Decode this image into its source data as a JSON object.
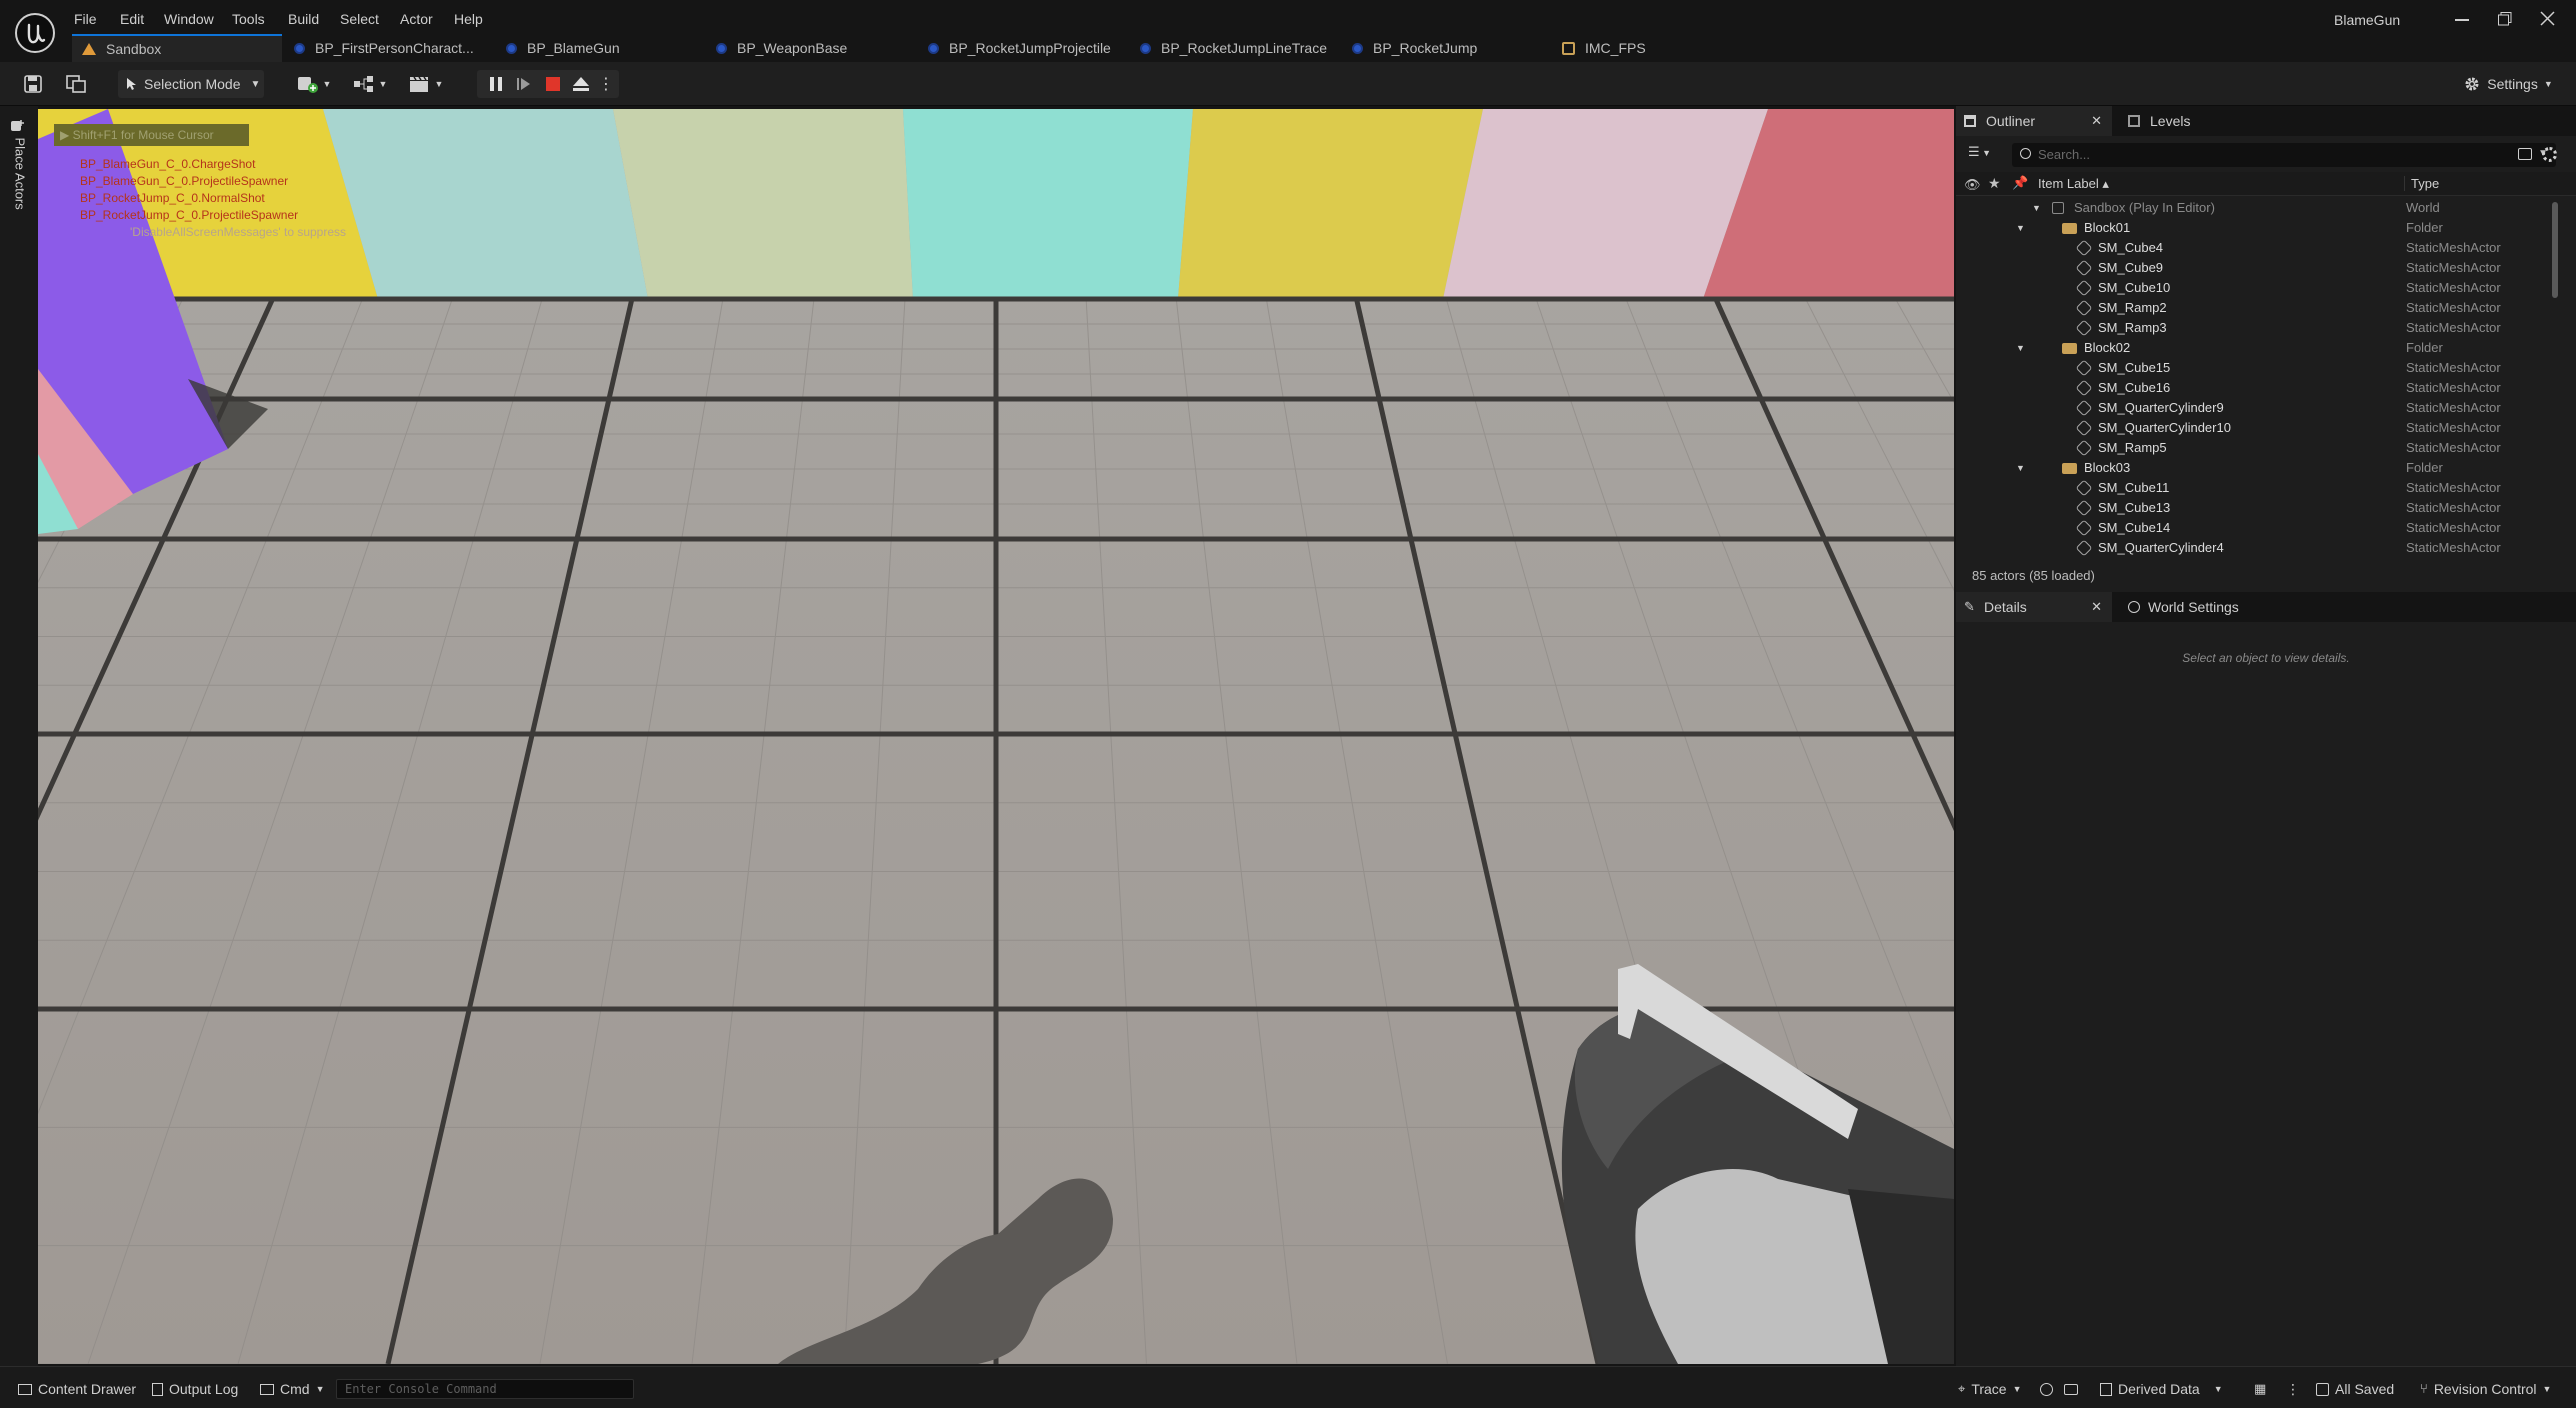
{
  "window": {
    "project_name": "BlameGun"
  },
  "menu": [
    "File",
    "Edit",
    "Window",
    "Tools",
    "Build",
    "Select",
    "Actor",
    "Help"
  ],
  "tabs": [
    {
      "label": "Sandbox",
      "icon": "level-icon"
    },
    {
      "label": "BP_FirstPersonCharact...",
      "icon": "blueprint-actor-icon"
    },
    {
      "label": "BP_BlameGun",
      "icon": "blueprint-icon"
    },
    {
      "label": "BP_WeaponBase",
      "icon": "blueprint-icon"
    },
    {
      "label": "BP_RocketJumpProjectile",
      "icon": "blueprint-icon"
    },
    {
      "label": "BP_RocketJumpLineTrace",
      "icon": "blueprint-icon"
    },
    {
      "label": "BP_RocketJump",
      "icon": "blueprint-icon"
    },
    {
      "label": "IMC_FPS",
      "icon": "input-mapping-icon"
    }
  ],
  "toolbar": {
    "selection_mode": "Selection Mode",
    "settings": "Settings"
  },
  "left_strip": {
    "label": "Place Actors"
  },
  "viewport": {
    "hint": "Shift+F1 for Mouse Cursor",
    "messages": [
      "BP_BlameGun_C_0.ChargeShot",
      "BP_BlameGun_C_0.ProjectileSpawner",
      "BP_RocketJump_C_0.NormalShot",
      "BP_RocketJump_C_0.ProjectileSpawner"
    ],
    "suppress_hint": "'DisableAllScreenMessages' to suppress",
    "colors": {
      "stripe1": "#e7d33a",
      "stripe2": "#a9d6d0",
      "stripe3": "#c8d3ab",
      "stripe4": "#8fded1",
      "stripe5": "#dccb4c",
      "stripe6": "#dcc1cd",
      "stripe7": "#cf6f79",
      "floor": "#a49f9a",
      "purple": "#8d5ce6"
    }
  },
  "outliner": {
    "tab": "Outliner",
    "levels_tab": "Levels",
    "search_placeholder": "Search...",
    "col_label": "Item Label",
    "col_type": "Type",
    "rows": [
      {
        "label": "Sandbox (Play In Editor)",
        "type": "World",
        "kind": "world",
        "indent": 0
      },
      {
        "label": "Block01",
        "type": "Folder",
        "kind": "folder",
        "indent": 1
      },
      {
        "label": "SM_Cube4",
        "type": "StaticMeshActor",
        "kind": "mesh",
        "indent": 2
      },
      {
        "label": "SM_Cube9",
        "type": "StaticMeshActor",
        "kind": "mesh",
        "indent": 2
      },
      {
        "label": "SM_Cube10",
        "type": "StaticMeshActor",
        "kind": "mesh",
        "indent": 2
      },
      {
        "label": "SM_Ramp2",
        "type": "StaticMeshActor",
        "kind": "mesh",
        "indent": 2
      },
      {
        "label": "SM_Ramp3",
        "type": "StaticMeshActor",
        "kind": "mesh",
        "indent": 2
      },
      {
        "label": "Block02",
        "type": "Folder",
        "kind": "folder",
        "indent": 1
      },
      {
        "label": "SM_Cube15",
        "type": "StaticMeshActor",
        "kind": "mesh",
        "indent": 2
      },
      {
        "label": "SM_Cube16",
        "type": "StaticMeshActor",
        "kind": "mesh",
        "indent": 2
      },
      {
        "label": "SM_QuarterCylinder9",
        "type": "StaticMeshActor",
        "kind": "mesh",
        "indent": 2
      },
      {
        "label": "SM_QuarterCylinder10",
        "type": "StaticMeshActor",
        "kind": "mesh",
        "indent": 2
      },
      {
        "label": "SM_Ramp5",
        "type": "StaticMeshActor",
        "kind": "mesh",
        "indent": 2
      },
      {
        "label": "Block03",
        "type": "Folder",
        "kind": "folder",
        "indent": 1
      },
      {
        "label": "SM_Cube11",
        "type": "StaticMeshActor",
        "kind": "mesh",
        "indent": 2
      },
      {
        "label": "SM_Cube13",
        "type": "StaticMeshActor",
        "kind": "mesh",
        "indent": 2
      },
      {
        "label": "SM_Cube14",
        "type": "StaticMeshActor",
        "kind": "mesh",
        "indent": 2
      },
      {
        "label": "SM_QuarterCylinder4",
        "type": "StaticMeshActor",
        "kind": "mesh",
        "indent": 2
      }
    ],
    "actor_count": "85 actors (85 loaded)"
  },
  "details": {
    "tab": "Details",
    "world_settings_tab": "World Settings",
    "empty_message": "Select an object to view details."
  },
  "statusbar": {
    "content_drawer": "Content Drawer",
    "output_log": "Output Log",
    "cmd": "Cmd",
    "console_placeholder": "Enter Console Command",
    "trace": "Trace",
    "derived_data": "Derived Data",
    "all_saved": "All Saved",
    "revision_control": "Revision Control"
  }
}
